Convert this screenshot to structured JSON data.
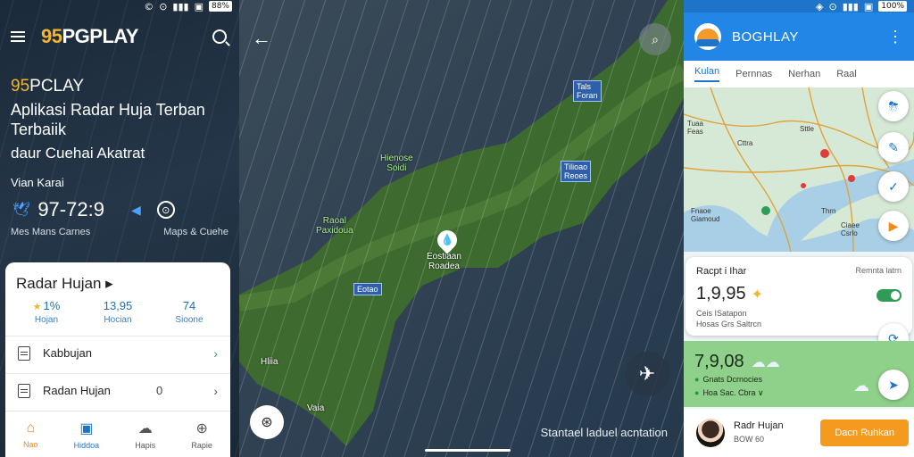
{
  "left": {
    "status_bar": {
      "icons": [
        "©",
        "⊙",
        "▮▮▮",
        "▣",
        "◈"
      ],
      "battery": "88%"
    },
    "brand": {
      "num": "95",
      "rest": "PGPLAY"
    },
    "hero": {
      "brand_num": "95",
      "brand_rest": "PCLAY",
      "title": "Aplikasi Radar Huja Terban Terbaiik",
      "subtitle": "daur Cuehai Akatrat",
      "location": "Vian Karai",
      "temperature": "97-72:9",
      "caption_left": "Mes Mans Carnes",
      "caption_right": "Maps & Cuehe"
    },
    "card": {
      "title": "Radar Hujan ▸",
      "stats": [
        {
          "value": "1%",
          "label": "Hojan"
        },
        {
          "value": "13,95",
          "label": "Hocian"
        },
        {
          "value": "74",
          "label": "Sioone"
        }
      ],
      "rows": [
        {
          "label": "Kabbujan",
          "trailing": ""
        },
        {
          "label": "Radan  Hujan",
          "trailing": "0"
        }
      ]
    },
    "tabs": [
      {
        "icon": "⌂",
        "label": "Nao"
      },
      {
        "icon": "▣",
        "label": "Hiddoa"
      },
      {
        "icon": "☁",
        "label": "Hapis"
      },
      {
        "icon": "⊕",
        "label": "Rapie"
      }
    ],
    "colors": {
      "accent": "#f2b531",
      "link": "#1e74c9"
    }
  },
  "map": {
    "labels": [
      {
        "text": "Hienose\nSoidi",
        "green": true
      },
      {
        "text": "Raoal\nPaxidoua",
        "green": true
      },
      {
        "text": "Eostiaan\nRoadea",
        "green": false
      },
      {
        "text": "Hliia",
        "green": false
      },
      {
        "text": "Vaia",
        "green": false
      }
    ],
    "tags": [
      "Tals\nForan",
      "Tilioao\nReoes",
      "Eotao"
    ],
    "footer_note": "Stantael laduel acntation"
  },
  "right": {
    "status_bar": {
      "icons": [
        "◈",
        "⊙",
        "▮▮▮",
        "▣"
      ],
      "battery": "100%"
    },
    "app_title": "BOGHLAY",
    "tabs": [
      "Kulan",
      "Pernnas",
      "Nerhan",
      "Raal"
    ],
    "map_labels": [
      "Tuaa\nFeas",
      "Sttle",
      "Cttra",
      "Fnaoe\nGiamoud",
      "Thrn",
      "Ciaee\nCsrlo"
    ],
    "info_card": {
      "title": "Racpt i Ihar",
      "right_text": "Remnta latrn",
      "value": "1,9,95",
      "sub1": "Ceis ISatapon",
      "sub2": "Hosas Grs Saltrcn"
    },
    "green_card": {
      "value": "7,9,08",
      "sub1": "Gnats Dcrnocies",
      "sub2": "Hoa Sac. Cbra  ∨"
    },
    "bottom": {
      "name": "Radr Hujan",
      "sub": "BOW 60",
      "cta": "Dacn Ruhkan"
    }
  }
}
